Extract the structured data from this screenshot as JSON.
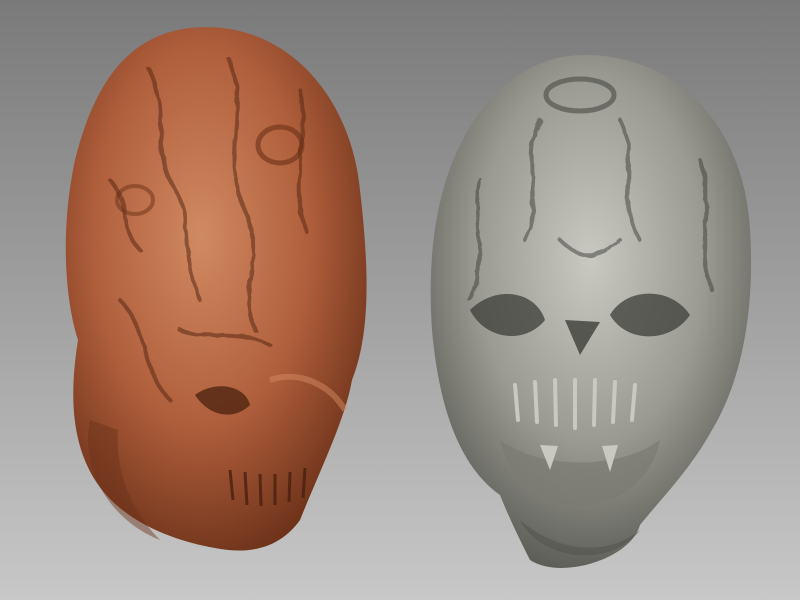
{
  "scene": {
    "background": {
      "top_color": "#7a7a7a",
      "bottom_color": "#c8c8c8"
    },
    "sculpts": [
      {
        "name": "clay-head-sculpt",
        "material": "terracotta-clay",
        "base_color": "#b05f3c",
        "shadow_color": "#5a2a15",
        "highlight_color": "#d48a62"
      },
      {
        "name": "stone-head-sculpt",
        "material": "grey-stone",
        "base_color": "#9a9a92",
        "shadow_color": "#3e3e3a",
        "highlight_color": "#c9c9c2"
      }
    ]
  }
}
